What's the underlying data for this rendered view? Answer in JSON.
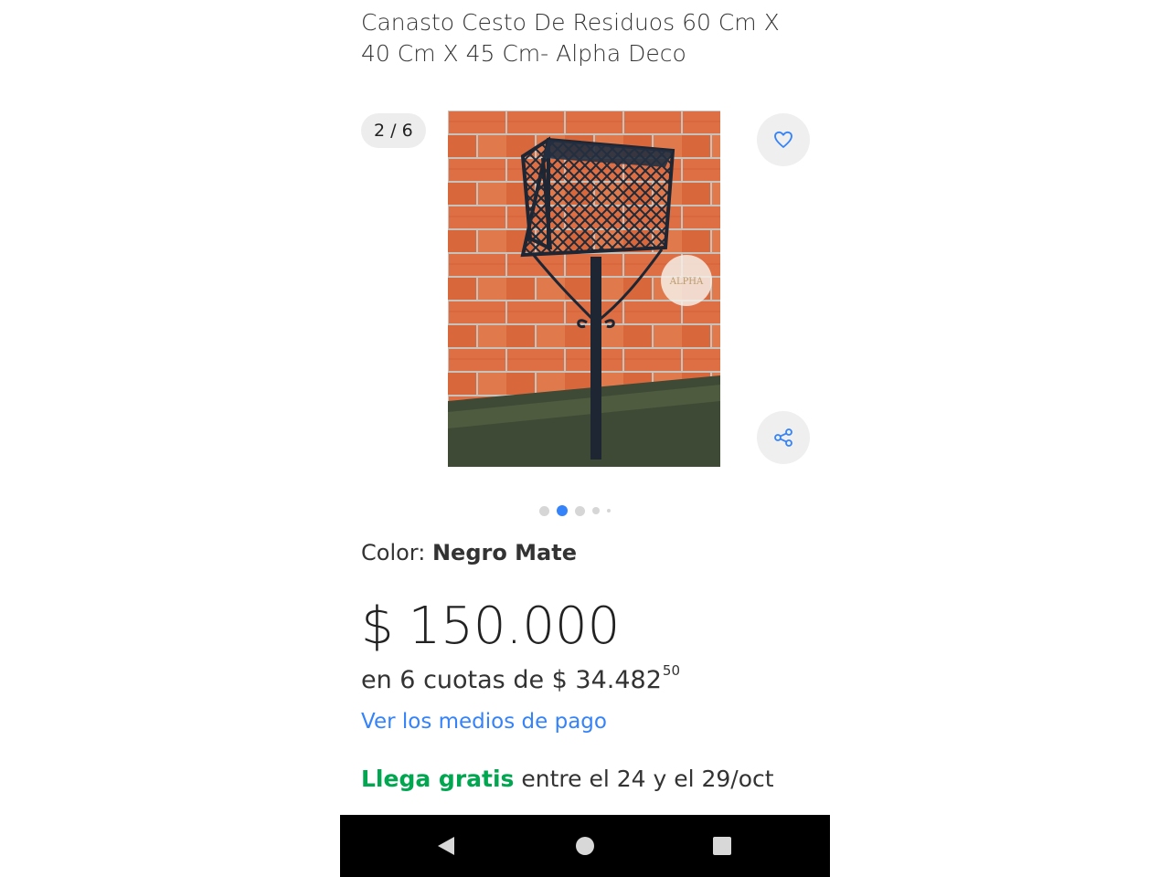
{
  "product": {
    "title": "Canasto Cesto De Residuos 60 Cm X 40 Cm X 45 Cm- Alpha Deco",
    "gallery": {
      "counter": "2 / 6",
      "current_index": 2,
      "total_images": 6,
      "watermark": "ALPHA",
      "favorite_icon": "heart-icon",
      "share_icon": "share-icon"
    },
    "color": {
      "label": "Color: ",
      "value": "Negro Mate"
    },
    "price": {
      "currency_symbol": "$",
      "value": "150.000"
    },
    "installments": {
      "prefix": "en 6 cuotas de $ 34.482",
      "cents": "50"
    },
    "payment_link": "Ver los medios de pago",
    "shipping": {
      "free_label": "Llega gratis",
      "dates": " entre el 24 y el 29/oct"
    }
  },
  "system_nav": {
    "back_icon": "back-triangle-icon",
    "home_icon": "home-circle-icon",
    "recents_icon": "recents-square-icon"
  },
  "colors": {
    "accent": "#3483fa",
    "free_shipping": "#00a650",
    "text": "#333333",
    "button_bg": "#efefef"
  }
}
